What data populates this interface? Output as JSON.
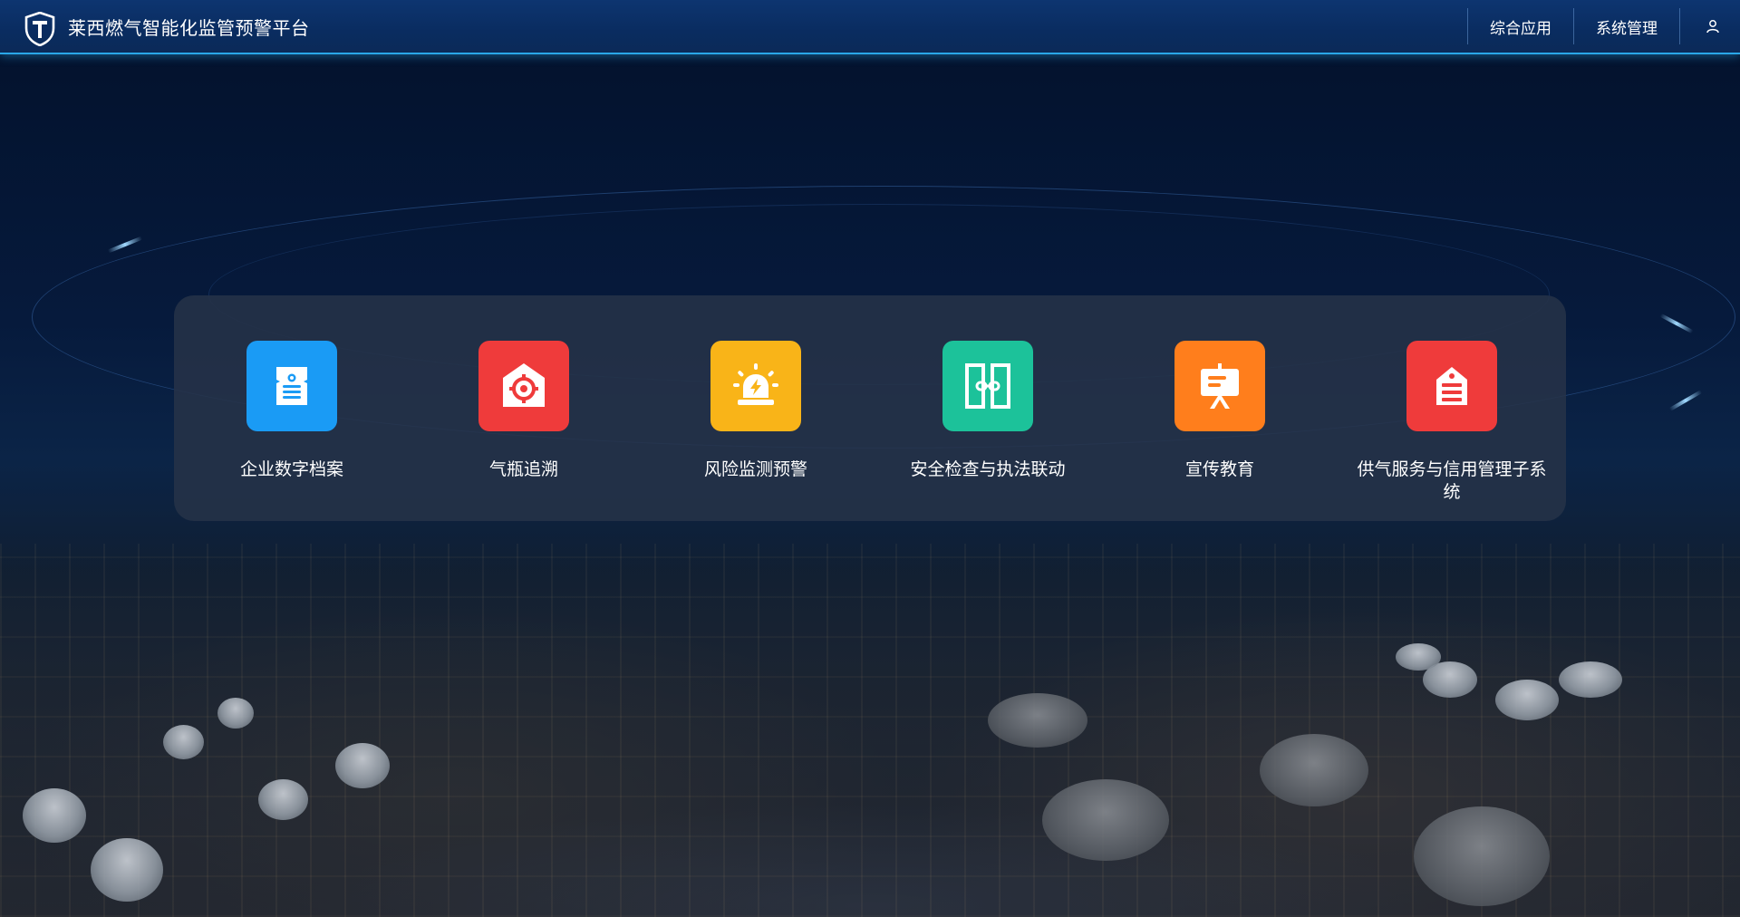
{
  "header": {
    "title": "莱西燃气智能化监管预警平台",
    "nav": [
      {
        "label": "综合应用"
      },
      {
        "label": "系统管理"
      }
    ]
  },
  "modules": [
    {
      "label": "企业数字档案",
      "color": "#1a9bf5",
      "icon": "archive-icon"
    },
    {
      "label": "气瓶追溯",
      "color": "#ef3b3b",
      "icon": "target-house-icon"
    },
    {
      "label": "风险监测预警",
      "color": "#f9b418",
      "icon": "alarm-light-icon"
    },
    {
      "label": "安全检查与执法联动",
      "color": "#1cc29a",
      "icon": "linked-doors-icon"
    },
    {
      "label": "宣传教育",
      "color": "#ff7e1c",
      "icon": "presentation-board-icon"
    },
    {
      "label": "供气服务与信用管理子系统",
      "color": "#ef3b3b",
      "icon": "list-tag-icon"
    }
  ],
  "colors": {
    "header_bg": "#0b2c5e",
    "header_border": "#2aa7e8",
    "panel_bg": "#263248"
  }
}
